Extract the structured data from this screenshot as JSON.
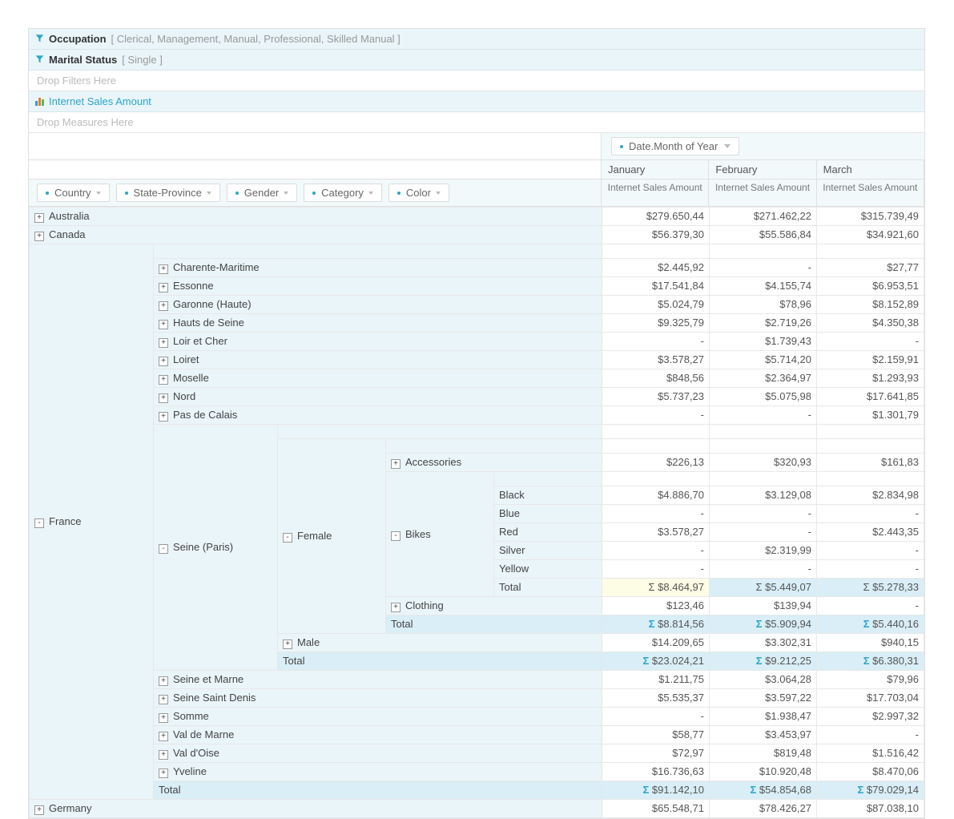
{
  "filters": {
    "occupation": {
      "label": "Occupation",
      "values": "[ Clerical, Management, Manual, Professional, Skilled Manual ]"
    },
    "marital": {
      "label": "Marital Status",
      "values": "[ Single ]"
    },
    "drop_filters": "Drop Filters Here",
    "measure": "Internet Sales Amount",
    "drop_measures": "Drop Measures Here"
  },
  "col_dim_label": "Date.Month of Year",
  "months": [
    "January",
    "February",
    "March"
  ],
  "measure_header": "Internet Sales Amount",
  "row_dims": [
    "Country",
    "State-Province",
    "Gender",
    "Category",
    "Color"
  ],
  "rows": [
    {
      "d": 0,
      "exp": "+",
      "label": "Australia",
      "v": [
        "$279.650,44",
        "$271.462,22",
        "$315.739,49"
      ]
    },
    {
      "d": 0,
      "exp": "+",
      "label": "Canada",
      "v": [
        "$56.379,30",
        "$55.586,84",
        "$34.921,60"
      ]
    },
    {
      "d": 0,
      "exp": "-",
      "label": "France",
      "v": [
        "",
        "",
        ""
      ],
      "france_open": true
    },
    {
      "d": 1,
      "exp": "+",
      "label": "Charente-Maritime",
      "v": [
        "$2.445,92",
        "-",
        "$27,77"
      ]
    },
    {
      "d": 1,
      "exp": "+",
      "label": "Essonne",
      "v": [
        "$17.541,84",
        "$4.155,74",
        "$6.953,51"
      ]
    },
    {
      "d": 1,
      "exp": "+",
      "label": "Garonne (Haute)",
      "v": [
        "$5.024,79",
        "$78,96",
        "$8.152,89"
      ]
    },
    {
      "d": 1,
      "exp": "+",
      "label": "Hauts de Seine",
      "v": [
        "$9.325,79",
        "$2.719,26",
        "$4.350,38"
      ]
    },
    {
      "d": 1,
      "exp": "+",
      "label": "Loir et Cher",
      "v": [
        "-",
        "$1.739,43",
        "-"
      ]
    },
    {
      "d": 1,
      "exp": "+",
      "label": "Loiret",
      "v": [
        "$3.578,27",
        "$5.714,20",
        "$2.159,91"
      ]
    },
    {
      "d": 1,
      "exp": "+",
      "label": "Moselle",
      "v": [
        "$848,56",
        "$2.364,97",
        "$1.293,93"
      ]
    },
    {
      "d": 1,
      "exp": "+",
      "label": "Nord",
      "v": [
        "$5.737,23",
        "$5.075,98",
        "$17.641,85"
      ]
    },
    {
      "d": 1,
      "exp": "+",
      "label": "Pas de Calais",
      "v": [
        "-",
        "-",
        "$1.301,79"
      ]
    },
    {
      "d": 1,
      "exp": "-",
      "label": "Seine (Paris)",
      "seine_open": true,
      "v": [
        "",
        "",
        ""
      ]
    },
    {
      "d": 2,
      "exp": "-",
      "label": "Female",
      "female_open": true,
      "v": [
        "",
        "",
        ""
      ]
    },
    {
      "d": 3,
      "exp": "+",
      "label": "Accessories",
      "v": [
        "$226,13",
        "$320,93",
        "$161,83"
      ]
    },
    {
      "d": 3,
      "exp": "-",
      "label": "Bikes",
      "bikes_open": true,
      "v": [
        "",
        "",
        ""
      ]
    },
    {
      "d": 4,
      "label": "Black",
      "v": [
        "$4.886,70",
        "$3.129,08",
        "$2.834,98"
      ]
    },
    {
      "d": 4,
      "label": "Blue",
      "v": [
        "-",
        "-",
        "-"
      ]
    },
    {
      "d": 4,
      "label": "Red",
      "v": [
        "$3.578,27",
        "-",
        "$2.443,35"
      ]
    },
    {
      "d": 4,
      "label": "Silver",
      "v": [
        "-",
        "$2.319,99",
        "-"
      ]
    },
    {
      "d": 4,
      "label": "Yellow",
      "v": [
        "-",
        "-",
        "-"
      ]
    },
    {
      "d": 4,
      "label": "Total",
      "v": [
        "$8.464,97",
        "$5.449,07",
        "$5.278,33"
      ],
      "sigma": true,
      "bikes_total": true
    },
    {
      "d": 3,
      "exp": "+",
      "label": "Clothing",
      "v": [
        "$123,46",
        "$139,94",
        "-"
      ]
    },
    {
      "d": 3,
      "label": "Total",
      "v": [
        "$8.814,56",
        "$5.909,94",
        "$5.440,16"
      ],
      "sigma": true,
      "total": true
    },
    {
      "d": 2,
      "exp": "+",
      "label": "Male",
      "v": [
        "$14.209,65",
        "$3.302,31",
        "$940,15"
      ]
    },
    {
      "d": 2,
      "label": "Total",
      "v": [
        "$23.024,21",
        "$9.212,25",
        "$6.380,31"
      ],
      "sigma": true,
      "total": true
    },
    {
      "d": 1,
      "exp": "+",
      "label": "Seine et Marne",
      "v": [
        "$1.211,75",
        "$3.064,28",
        "$79,96"
      ]
    },
    {
      "d": 1,
      "exp": "+",
      "label": "Seine Saint Denis",
      "v": [
        "$5.535,37",
        "$3.597,22",
        "$17.703,04"
      ]
    },
    {
      "d": 1,
      "exp": "+",
      "label": "Somme",
      "v": [
        "-",
        "$1.938,47",
        "$2.997,32"
      ]
    },
    {
      "d": 1,
      "exp": "+",
      "label": "Val de Marne",
      "v": [
        "$58,77",
        "$3.453,97",
        "-"
      ]
    },
    {
      "d": 1,
      "exp": "+",
      "label": "Val d'Oise",
      "v": [
        "$72,97",
        "$819,48",
        "$1.516,42"
      ]
    },
    {
      "d": 1,
      "exp": "+",
      "label": "Yveline",
      "v": [
        "$16.736,63",
        "$10.920,48",
        "$8.470,06"
      ]
    },
    {
      "d": 1,
      "label": "Total",
      "v": [
        "$91.142,10",
        "$54.854,68",
        "$79.029,14"
      ],
      "sigma": true,
      "total": true
    },
    {
      "d": 0,
      "exp": "+",
      "label": "Germany",
      "v": [
        "$65.548,71",
        "$78.426,27",
        "$87.038,10"
      ]
    }
  ]
}
